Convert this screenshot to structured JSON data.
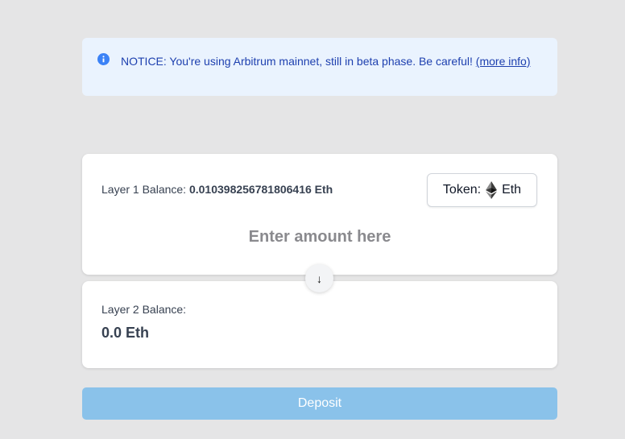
{
  "notice": {
    "text": "NOTICE: You're using Arbitrum mainnet, still in beta phase. Be careful!",
    "link_text": "(more info)",
    "icon": "info-icon"
  },
  "layer1": {
    "balance_label": "Layer 1 Balance:",
    "balance_value": "0.010398256781806416 Eth",
    "token_label": "Token:",
    "token_symbol": "Eth",
    "token_icon": "ethereum-icon",
    "amount_placeholder": "Enter amount here"
  },
  "swap_arrow": "↓",
  "layer2": {
    "balance_label": "Layer 2 Balance:",
    "balance_value": "0.0 Eth"
  },
  "deposit": {
    "label": "Deposit"
  },
  "colors": {
    "background": "#e5e5e6",
    "notice_bg": "#eaf3fe",
    "notice_text": "#1e40af",
    "deposit_bg": "#8ac2ea"
  }
}
